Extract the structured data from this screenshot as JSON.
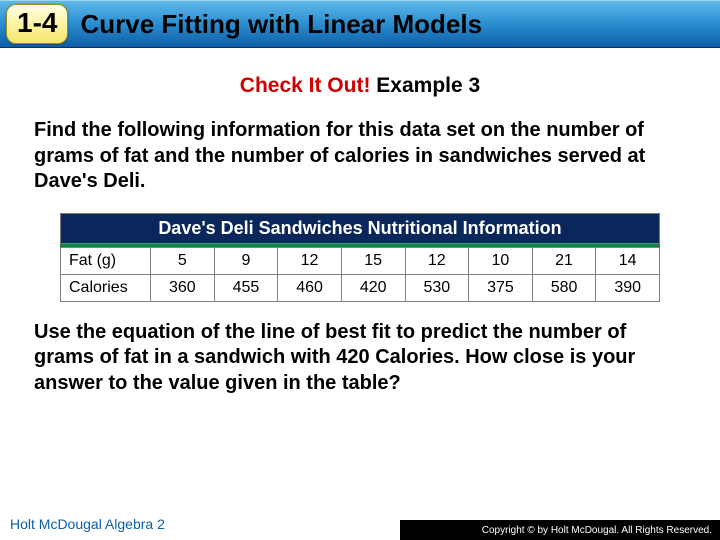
{
  "header": {
    "lesson_badge": "1-4",
    "title": "Curve Fitting with Linear Models"
  },
  "subhead": {
    "red": "Check It Out! ",
    "black": "Example 3"
  },
  "prompt1": "Find the following information for this data set on the number of grams of fat and the number of calories in sandwiches served at Dave's Deli.",
  "table": {
    "title": "Dave's Deli Sandwiches Nutritional Information",
    "rows": [
      {
        "label": "Fat (g)",
        "values": [
          "5",
          "9",
          "12",
          "15",
          "12",
          "10",
          "21",
          "14"
        ]
      },
      {
        "label": "Calories",
        "values": [
          "360",
          "455",
          "460",
          "420",
          "530",
          "375",
          "580",
          "390"
        ]
      }
    ]
  },
  "prompt2": "Use the equation of the line of best fit to predict the number of grams of fat in a sandwich with 420 Calories. How close is your answer to the value given in the table?",
  "footer": {
    "left": "Holt McDougal Algebra 2",
    "right": "Copyright © by Holt McDougal. All Rights Reserved."
  },
  "chart_data": {
    "type": "table",
    "title": "Dave's Deli Sandwiches Nutritional Information",
    "columns": [
      "Fat (g)",
      "Calories"
    ],
    "data": [
      {
        "fat_g": 5,
        "calories": 360
      },
      {
        "fat_g": 9,
        "calories": 455
      },
      {
        "fat_g": 12,
        "calories": 460
      },
      {
        "fat_g": 15,
        "calories": 420
      },
      {
        "fat_g": 12,
        "calories": 530
      },
      {
        "fat_g": 10,
        "calories": 375
      },
      {
        "fat_g": 21,
        "calories": 580
      },
      {
        "fat_g": 14,
        "calories": 390
      }
    ]
  }
}
